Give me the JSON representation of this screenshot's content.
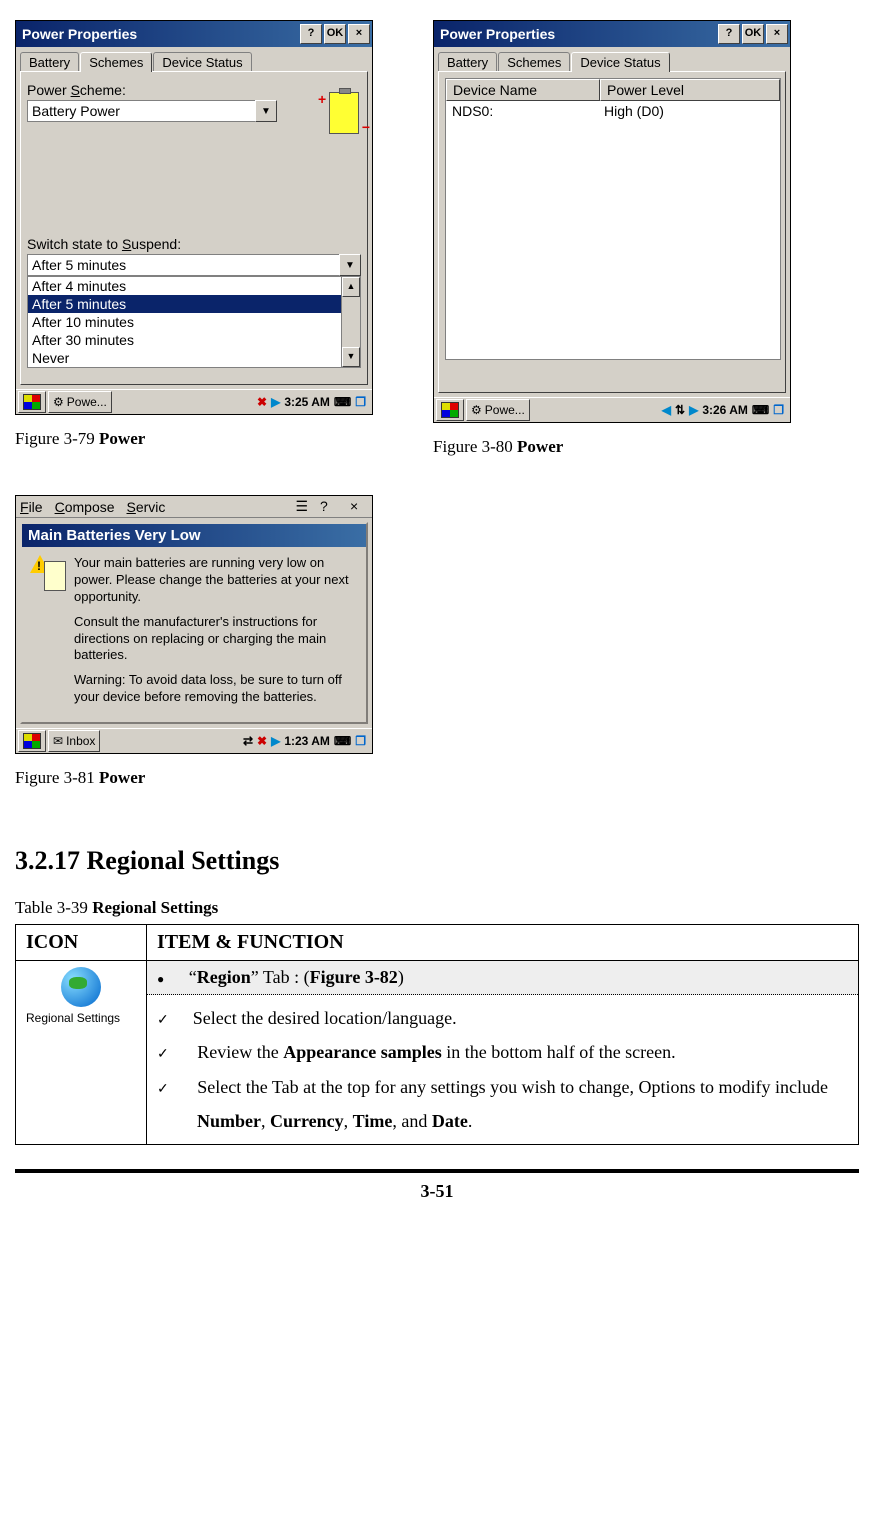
{
  "fig79": {
    "title": "Power Properties",
    "ok": "OK",
    "help": "?",
    "close": "×",
    "tabs": {
      "battery": "Battery",
      "schemes": "Schemes",
      "device": "Device Status"
    },
    "scheme_label_pre": "Power ",
    "scheme_label_u": "S",
    "scheme_label_post": "cheme:",
    "scheme_value": "Battery Power",
    "suspend_label_pre": "Switch state to ",
    "suspend_label_u": "S",
    "suspend_label_post": "uspend:",
    "suspend_value": "After 5 minutes",
    "options": [
      "After 4 minutes",
      "After 5 minutes",
      "After 10 minutes",
      "After 30 minutes",
      "Never"
    ],
    "taskbar_app": "Powe...",
    "taskbar_time": "3:25 AM",
    "caption_pre": "Figure 3-79 ",
    "caption_bold": "Power"
  },
  "fig80": {
    "title": "Power Properties",
    "ok": "OK",
    "help": "?",
    "close": "×",
    "tabs": {
      "battery": "Battery",
      "schemes": "Schemes",
      "device": "Device Status"
    },
    "col1": "Device Name",
    "col2": "Power Level",
    "row_name": "NDS0:",
    "row_level": "High   (D0)",
    "taskbar_app": "Powe...",
    "taskbar_time": "3:26 AM",
    "caption_pre": "Figure 3-80 ",
    "caption_bold": "Power"
  },
  "fig81": {
    "menu": {
      "file": "File",
      "compose": "Compose",
      "servic": "Servic"
    },
    "help": "?",
    "close": "×",
    "modal_title": "Main Batteries Very Low",
    "p1": "Your main batteries are running very low on power. Please change the batteries at your next opportunity.",
    "p2": "Consult the manufacturer's instructions for directions on replacing or charging the main batteries.",
    "p3": "Warning: To avoid data loss, be sure to turn off your device before removing the batteries.",
    "taskbar_app": "Inbox",
    "taskbar_time": "1:23 AM",
    "caption_pre": "Figure 3-81 ",
    "caption_bold": "Power"
  },
  "section_heading": "3.2.17 Regional Settings",
  "table_caption_pre": "Table 3-39 ",
  "table_caption_bold": "Regional Settings",
  "table": {
    "hdr_icon": "ICON",
    "hdr_item": "ITEM & FUNCTION",
    "icon_label": "Regional Settings",
    "row_bullet_pre": "“",
    "row_bullet_bold": "Region",
    "row_bullet_mid": "” Tab",
    "row_bullet_colon": " : (",
    "row_bullet_fig": "Figure 3-82",
    "row_bullet_end": ")",
    "check1": "Select the desired location/language.",
    "check2_pre": "Review the ",
    "check2_bold": "Appearance samples",
    "check2_post": " in the bottom half of the screen.",
    "check3_pre": "Select the Tab at the top for any settings you wish to change, Options to modify include ",
    "check3_b1": "Number",
    "check3_s1": ", ",
    "check3_b2": "Currency",
    "check3_s2": ", ",
    "check3_b3": "Time",
    "check3_s3": ", and ",
    "check3_b4": "Date",
    "check3_end": "."
  },
  "page_number": "3-51"
}
